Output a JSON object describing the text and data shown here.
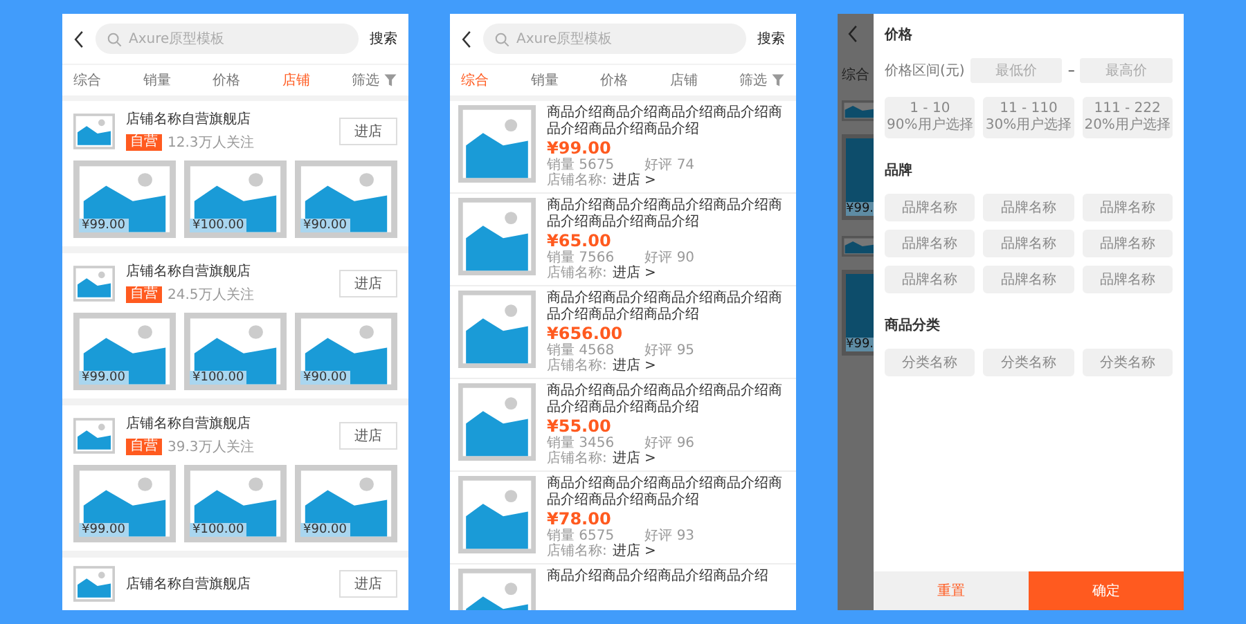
{
  "screens": [
    {
      "kind": "stores",
      "search": {
        "placeholder": "Axure原型模板",
        "button": "搜索"
      },
      "tabs": [
        {
          "label": "综合",
          "selected": false
        },
        {
          "label": "销量",
          "selected": false
        },
        {
          "label": "价格",
          "selected": false
        },
        {
          "label": "店铺",
          "selected": true
        }
      ],
      "filter": "筛选",
      "stores": [
        {
          "name": "店铺名称自营旗舰店",
          "badge": "自营",
          "followers": "12.3万人关注",
          "button": "进店",
          "prices": [
            "¥99.00",
            "¥100.00",
            "¥90.00"
          ]
        },
        {
          "name": "店铺名称自营旗舰店",
          "badge": "自营",
          "followers": "24.5万人关注",
          "button": "进店",
          "prices": [
            "¥99.00",
            "¥100.00",
            "¥90.00"
          ]
        },
        {
          "name": "店铺名称自营旗舰店",
          "badge": "自营",
          "followers": "39.3万人关注",
          "button": "进店",
          "prices": [
            "¥99.00",
            "¥100.00",
            "¥90.00"
          ]
        },
        {
          "name": "店铺名称自营旗舰店",
          "button": "进店"
        }
      ]
    },
    {
      "kind": "products",
      "search": {
        "placeholder": "Axure原型模板",
        "button": "搜索"
      },
      "tabs": [
        {
          "label": "综合",
          "selected": true
        },
        {
          "label": "销量",
          "selected": false
        },
        {
          "label": "价格",
          "selected": false
        },
        {
          "label": "店铺",
          "selected": false
        }
      ],
      "filter": "筛选",
      "products": [
        {
          "desc": "商品介绍商品介绍商品介绍商品介绍商品介绍商品介绍商品介绍",
          "price": "¥99.00",
          "sales": "销量 5675",
          "rating": "好评 74",
          "shop": "店铺名称:",
          "enter": "进店 >"
        },
        {
          "desc": "商品介绍商品介绍商品介绍商品介绍商品介绍商品介绍商品介绍",
          "price": "¥65.00",
          "sales": "销量 7566",
          "rating": "好评 90",
          "shop": "店铺名称:",
          "enter": "进店 >"
        },
        {
          "desc": "商品介绍商品介绍商品介绍商品介绍商品介绍商品介绍商品介绍",
          "price": "¥656.00",
          "sales": "销量 4568",
          "rating": "好评 95",
          "shop": "店铺名称:",
          "enter": "进店 >"
        },
        {
          "desc": "商品介绍商品介绍商品介绍商品介绍商品介绍商品介绍商品介绍",
          "price": "¥55.00",
          "sales": "销量 3456",
          "rating": "好评 96",
          "shop": "店铺名称:",
          "enter": "进店 >"
        },
        {
          "desc": "商品介绍商品介绍商品介绍商品介绍商品介绍商品介绍商品介绍",
          "price": "¥78.00",
          "sales": "销量 6575",
          "rating": "好评 93",
          "shop": "店铺名称:",
          "enter": "进店 >"
        },
        {
          "desc": "商品介绍商品介绍商品介绍商品介绍"
        }
      ]
    },
    {
      "kind": "filter",
      "underlay": {
        "tab": "综合",
        "prices": [
          "¥99.",
          "¥99."
        ]
      },
      "price": {
        "title": "价格",
        "range_label": "价格区间(元)",
        "min_placeholder": "最低价",
        "dash": "–",
        "max_placeholder": "最高价",
        "options": [
          {
            "range": "1 - 10",
            "share": "90%用户选择",
            "selected": false
          },
          {
            "range": "11 - 110",
            "share": "30%用户选择",
            "selected": false
          },
          {
            "range": "111 - 222",
            "share": "20%用户选择",
            "selected": false
          }
        ]
      },
      "brand": {
        "title": "品牌",
        "options": [
          {
            "label": "品牌名称",
            "selected": false
          },
          {
            "label": "品牌名称",
            "selected": false
          },
          {
            "label": "品牌名称",
            "selected": false
          },
          {
            "label": "品牌名称",
            "selected": false
          },
          {
            "label": "品牌名称",
            "selected": false
          },
          {
            "label": "品牌名称",
            "selected": false
          },
          {
            "label": "品牌名称",
            "selected": false
          },
          {
            "label": "品牌名称",
            "selected": false
          },
          {
            "label": "品牌名称",
            "selected": false
          }
        ]
      },
      "category": {
        "title": "商品分类",
        "options": [
          {
            "label": "分类名称",
            "selected": false
          },
          {
            "label": "分类名称",
            "selected": false
          },
          {
            "label": "分类名称",
            "selected": false
          }
        ]
      },
      "reset": "重置",
      "confirm": "确定"
    }
  ]
}
